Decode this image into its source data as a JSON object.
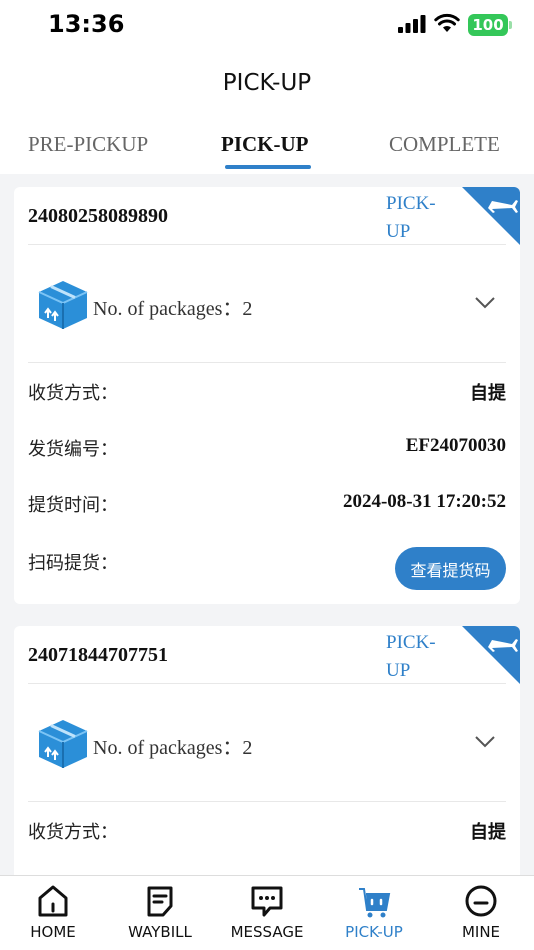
{
  "status_bar": {
    "time": "13:36",
    "battery": "100"
  },
  "header": {
    "title": "PICK-UP"
  },
  "tabs": [
    {
      "label": "PRE-PICKUP",
      "active": false
    },
    {
      "label": "PICK-UP",
      "active": true
    },
    {
      "label": "COMPLETE",
      "active": false
    }
  ],
  "orders": [
    {
      "order_no": "24080258089890",
      "status": "PICK-UP",
      "packages_label": "No. of packages：",
      "packages_count": "2",
      "rows": [
        {
          "label": "收货方式：",
          "value": "自提"
        },
        {
          "label": "发货编号：",
          "value": "EF24070030"
        },
        {
          "label": "提货时间：",
          "value": "2024-08-31 17:20:52"
        },
        {
          "label": "扫码提货：",
          "value": ""
        }
      ],
      "qr_button": "查看提货码"
    },
    {
      "order_no": "24071844707751",
      "status": "PICK-UP",
      "packages_label": "No. of packages：",
      "packages_count": "2",
      "rows": [
        {
          "label": "收货方式：",
          "value": "自提"
        }
      ]
    }
  ],
  "bottom_nav": [
    {
      "label": "HOME",
      "icon": "home-icon"
    },
    {
      "label": "WAYBILL",
      "icon": "waybill-icon"
    },
    {
      "label": "MESSAGE",
      "icon": "message-icon"
    },
    {
      "label": "PICK-UP",
      "icon": "cart-icon",
      "active": true
    },
    {
      "label": "MINE",
      "icon": "mine-icon"
    }
  ],
  "colors": {
    "accent": "#2f80c9",
    "battery": "#34c759",
    "background": "#f3f4f6"
  }
}
